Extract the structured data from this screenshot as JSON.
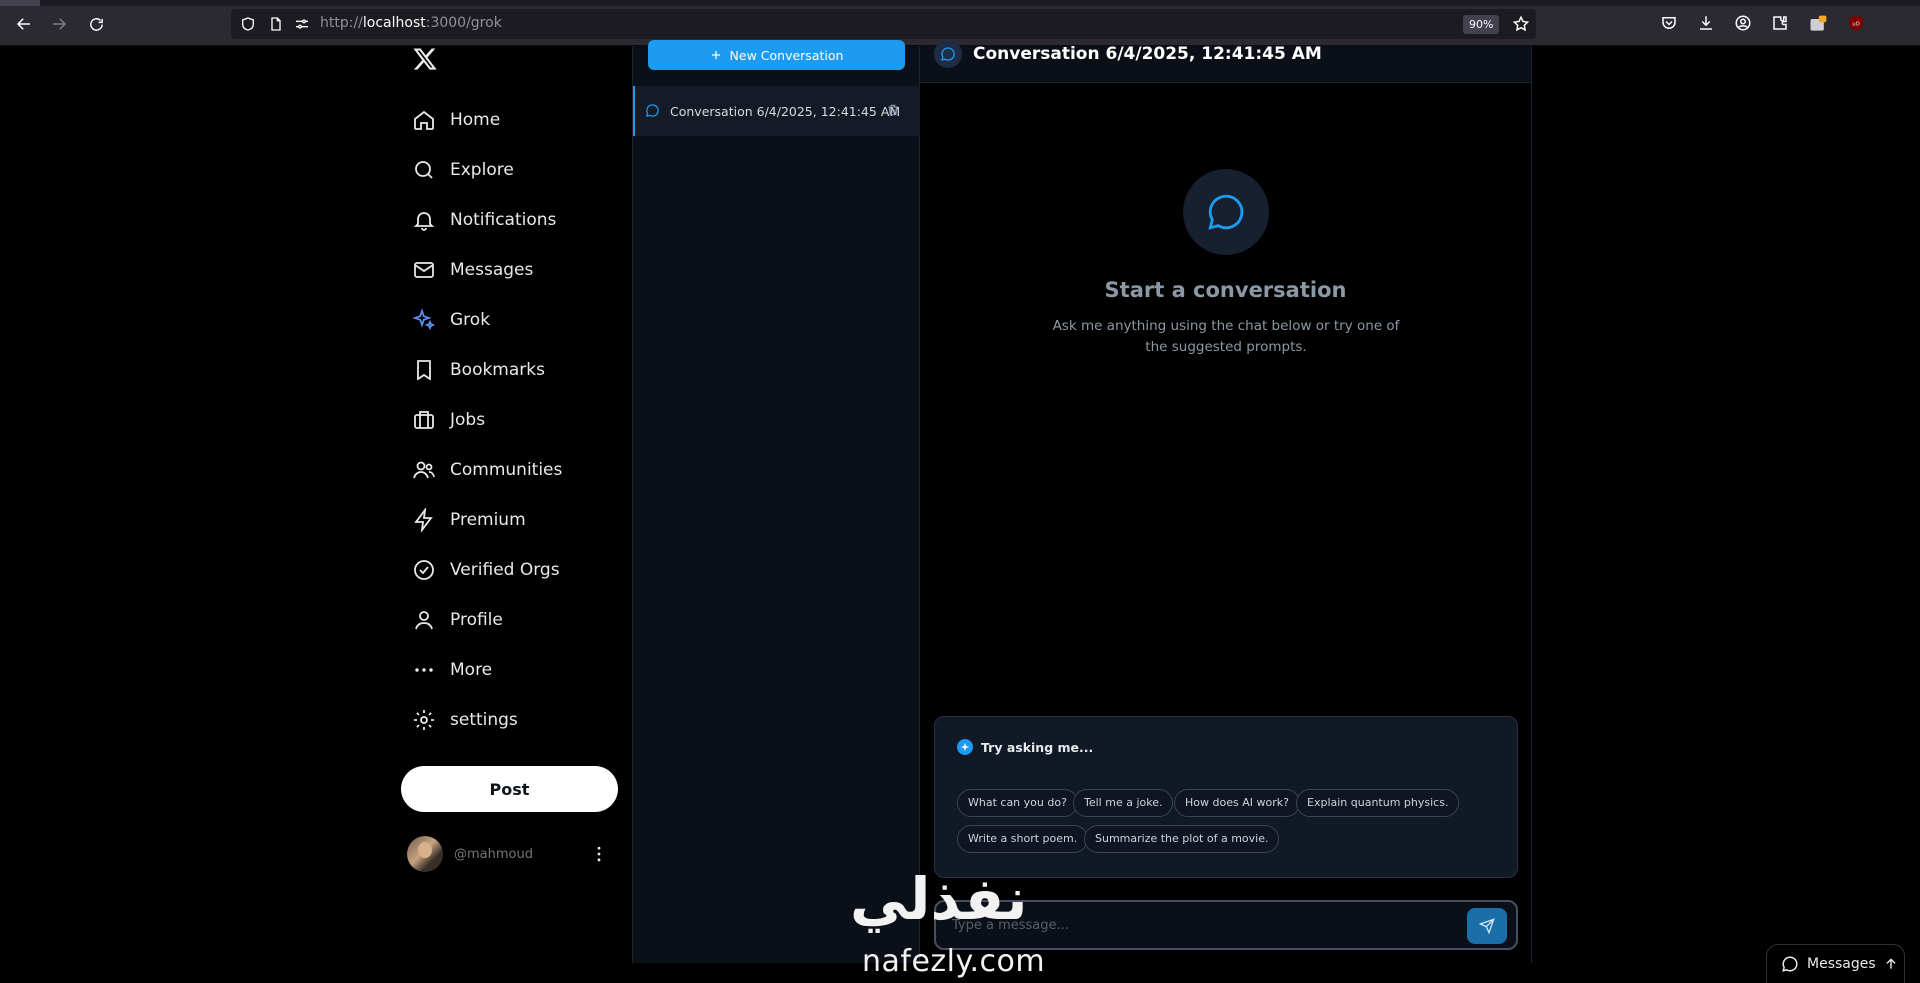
{
  "browser": {
    "url_prefix": "http://",
    "url_host": "localhost",
    "url_suffix": ":3000/grok",
    "zoom": "90%"
  },
  "sidebar": {
    "items": [
      {
        "label": "Home",
        "icon": "home-icon"
      },
      {
        "label": "Explore",
        "icon": "search-icon"
      },
      {
        "label": "Notifications",
        "icon": "bell-icon"
      },
      {
        "label": "Messages",
        "icon": "mail-icon"
      },
      {
        "label": "Grok",
        "icon": "sparkle-icon"
      },
      {
        "label": "Bookmarks",
        "icon": "bookmark-icon"
      },
      {
        "label": "Jobs",
        "icon": "briefcase-icon"
      },
      {
        "label": "Communities",
        "icon": "people-icon"
      },
      {
        "label": "Premium",
        "icon": "lightning-icon"
      },
      {
        "label": "Verified Orgs",
        "icon": "check-circle-icon"
      },
      {
        "label": "Profile",
        "icon": "user-icon"
      },
      {
        "label": "More",
        "icon": "more-dots-icon"
      },
      {
        "label": "settings",
        "icon": "gear-icon"
      }
    ],
    "post_label": "Post",
    "handle": "@mahmoud"
  },
  "conversations": {
    "new_label": "New Conversation",
    "items": [
      {
        "title": "Conversation 6/4/2025, 12:41:45 AM"
      }
    ]
  },
  "chat": {
    "title": "Conversation 6/4/2025, 12:41:45 AM",
    "empty_title": "Start a conversation",
    "empty_sub": "Ask me anything using the chat below or try one of the suggested prompts.",
    "suggest_heading": "Try asking me...",
    "suggestions": [
      "What can you do?",
      "Tell me a joke.",
      "How does AI work?",
      "Explain quantum physics.",
      "Write a short poem.",
      "Summarize the plot of a movie."
    ],
    "input_placeholder": "Type a message..."
  },
  "watermark": {
    "arabic": "نفذلي",
    "latin": "nafezly.com"
  },
  "drawer": {
    "label": "Messages"
  },
  "colors": {
    "accent": "#1d9bf0",
    "grok_active": "#5b8def",
    "background": "#000000",
    "panel": "#0b0f17"
  }
}
